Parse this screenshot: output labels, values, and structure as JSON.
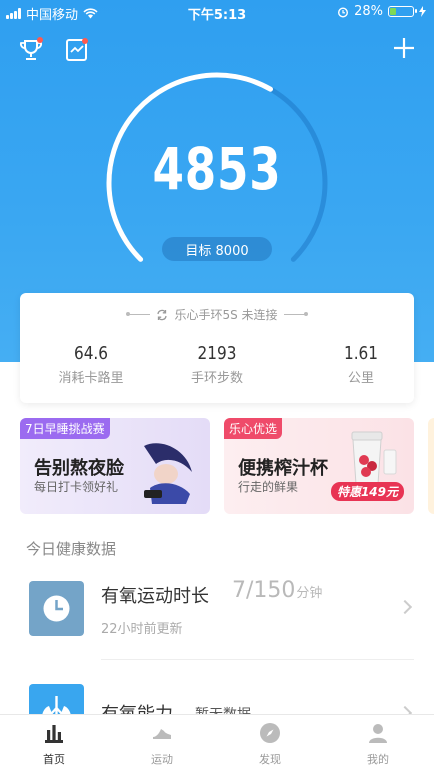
{
  "status_bar": {
    "carrier": "中国移动",
    "time": "下午5:13",
    "battery": "28%",
    "battery_level": 0.28
  },
  "steps": {
    "count": "4853",
    "goal_label": "目标 8000",
    "progress": 0.61
  },
  "device": {
    "status": "乐心手环5S 未连接"
  },
  "metrics": [
    {
      "value": "64.6",
      "label": "消耗卡路里"
    },
    {
      "value": "2193",
      "label": "手环步数"
    },
    {
      "value": "1.61",
      "label": "公里"
    }
  ],
  "banners": [
    {
      "tag": "7日早睡挑战赛",
      "title": "告别熬夜脸",
      "subtitle": "每日打卡领好礼"
    },
    {
      "tag": "乐心优选",
      "title": "便携榨汁杯",
      "subtitle": "行走的鲜果",
      "price": "特惠149元"
    }
  ],
  "section_title": "今日健康数据",
  "health_rows": [
    {
      "title": "有氧运动时长",
      "value": "7/150",
      "unit": "分钟",
      "subtitle": "22小时前更新"
    },
    {
      "title": "有氧能力",
      "value": "暂无数据"
    }
  ],
  "tabs": [
    {
      "label": "首页",
      "icon": "home-chart-icon",
      "active": true
    },
    {
      "label": "运动",
      "icon": "shoe-icon",
      "active": false
    },
    {
      "label": "发现",
      "icon": "compass-icon",
      "active": false
    },
    {
      "label": "我的",
      "icon": "person-icon",
      "active": false
    }
  ],
  "colors": {
    "hero_blue": "#3aa7f2",
    "accent_red": "#ff5a4e",
    "battery_green": "#7ed957"
  }
}
